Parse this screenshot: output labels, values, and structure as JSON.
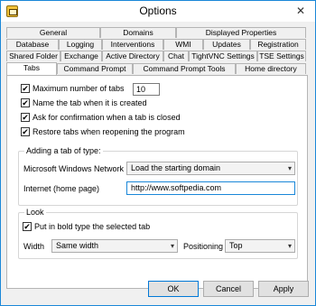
{
  "window": {
    "title": "Options",
    "close_glyph": "✕"
  },
  "tabs": {
    "row1": [
      "General",
      "Domains",
      "Displayed Properties"
    ],
    "row2": [
      "Database",
      "Logging",
      "Interventions",
      "WMI",
      "Updates",
      "Registration"
    ],
    "row3": [
      "Shared Folder",
      "Exchange",
      "Active Directory",
      "Chat",
      "TightVNC Settings",
      "TSE Settings"
    ],
    "row4": [
      "Tabs",
      "Command Prompt",
      "Command Prompt Tools",
      "Home directory"
    ],
    "active": "Tabs"
  },
  "settings": {
    "max_tabs": {
      "label": "Maximum number of tabs",
      "value": "10",
      "checked": true
    },
    "name_tab": {
      "label": "Name the tab when it is created",
      "checked": true
    },
    "ask_confirm": {
      "label": "Ask for confirmation when a tab is closed",
      "checked": true
    },
    "restore_tabs": {
      "label": "Restore tabs when reopening the program",
      "checked": true
    }
  },
  "adding_group": {
    "title": "Adding a tab of type:",
    "network_label": "Microsoft Windows Network",
    "network_value": "Load the starting domain",
    "internet_label": "Internet (home page)",
    "internet_value": "http://www.softpedia.com"
  },
  "look_group": {
    "title": "Look",
    "bold_label": "Put in bold type the selected tab",
    "bold_checked": true,
    "width_label": "Width",
    "width_value": "Same width",
    "positioning_label": "Positioning",
    "positioning_value": "Top"
  },
  "buttons": {
    "ok": "OK",
    "cancel": "Cancel",
    "apply": "Apply"
  },
  "check_glyph": "✔",
  "arrow_glyph": "▾"
}
